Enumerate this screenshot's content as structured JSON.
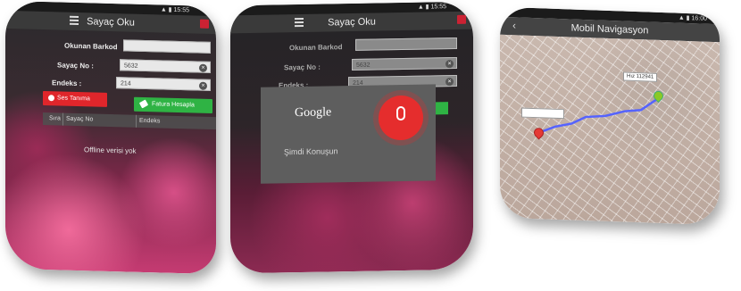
{
  "screen1": {
    "title": "Sayaç Oku",
    "fields": [
      {
        "label": "Okunan Barkod",
        "value": ""
      },
      {
        "label": "Sayaç No :",
        "value": "5632"
      },
      {
        "label": "Endeks :",
        "value": "214"
      }
    ],
    "buttons": {
      "voice": "Ses Tanıma",
      "invoice": "Fatura Hesapla"
    },
    "table_headers": [
      "Sıra",
      "Sayaç No",
      "Endeks"
    ],
    "empty_message": "Offline verisi yok"
  },
  "screen2": {
    "title": "Sayaç Oku",
    "fields": [
      {
        "label": "Okunan Barkod",
        "value": ""
      },
      {
        "label": "Sayaç No :",
        "value": "5632"
      },
      {
        "label": "Endeks :",
        "value": "214"
      }
    ],
    "dialog": {
      "brand": "Google",
      "prompt": "Şimdi Konuşun"
    }
  },
  "screen3": {
    "title": "Mobil Navigasyon",
    "callouts": {
      "top": "Hız 112941",
      "left": ""
    }
  },
  "colors": {
    "accent_red": "#e0262b",
    "accent_green": "#2fb344",
    "title_bar": "#3a3a3a"
  },
  "icons": [
    "menu-icon",
    "calendar-icon",
    "clear-icon",
    "voice-icon",
    "tag-icon",
    "microphone-icon",
    "back-icon",
    "map-pin-icon"
  ]
}
